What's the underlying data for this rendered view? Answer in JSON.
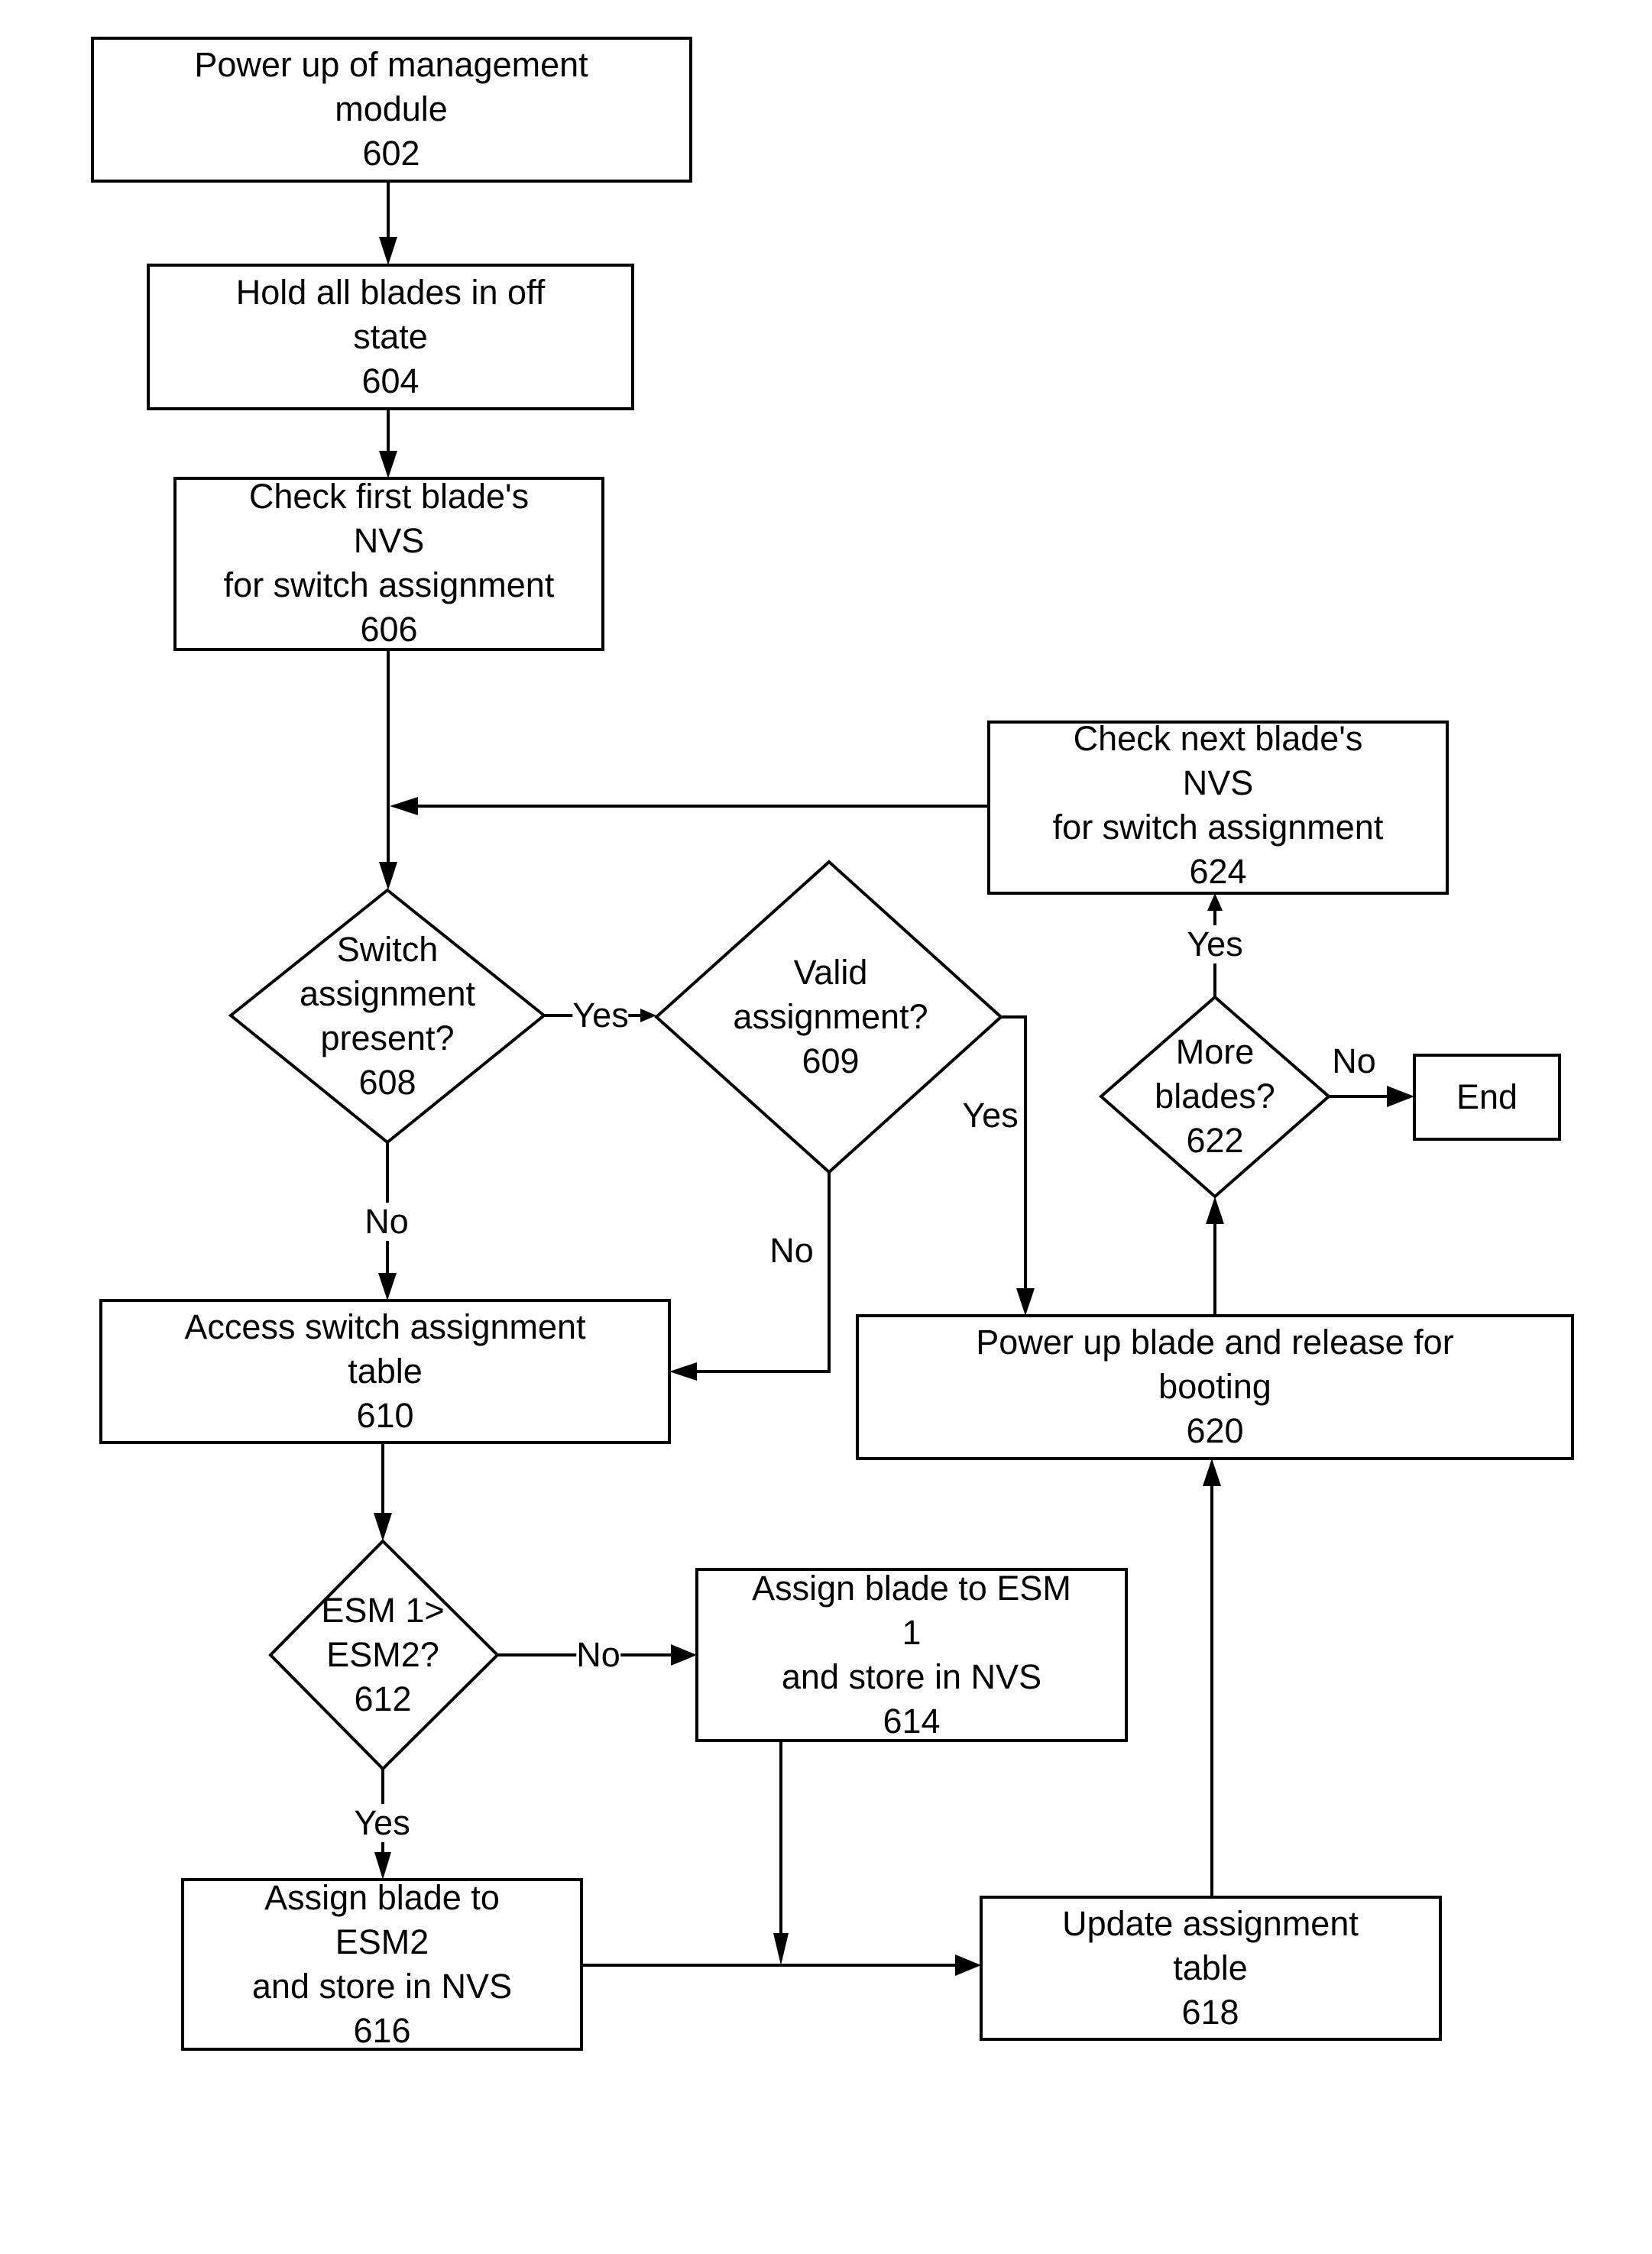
{
  "diagram": {
    "type": "flowchart",
    "nodes": [
      {
        "id": "602",
        "shape": "process",
        "lines": [
          "Power up of management",
          "module",
          "602"
        ]
      },
      {
        "id": "604",
        "shape": "process",
        "lines": [
          "Hold all blades in off",
          "state",
          "604"
        ]
      },
      {
        "id": "606",
        "shape": "process",
        "lines": [
          "Check first blade's",
          "NVS",
          "for switch assignment",
          "606"
        ]
      },
      {
        "id": "608",
        "shape": "decision",
        "lines": [
          "Switch",
          "assignment",
          "present?",
          "608"
        ]
      },
      {
        "id": "609",
        "shape": "decision",
        "lines": [
          "Valid",
          "assignment?",
          "609"
        ]
      },
      {
        "id": "610",
        "shape": "process",
        "lines": [
          "Access switch assignment",
          "table",
          "610"
        ]
      },
      {
        "id": "612",
        "shape": "decision",
        "lines": [
          "ESM 1>",
          "ESM2?",
          "612"
        ]
      },
      {
        "id": "614",
        "shape": "process",
        "lines": [
          "Assign blade to ESM",
          "1",
          "and store in NVS",
          "614"
        ]
      },
      {
        "id": "616",
        "shape": "process",
        "lines": [
          "Assign blade to",
          "ESM2",
          "and store in NVS",
          "616"
        ]
      },
      {
        "id": "618",
        "shape": "process",
        "lines": [
          "Update assignment",
          "table",
          "618"
        ]
      },
      {
        "id": "620",
        "shape": "process",
        "lines": [
          "Power up blade and release for",
          "booting",
          "620"
        ]
      },
      {
        "id": "622",
        "shape": "decision",
        "lines": [
          "More",
          "blades?",
          "622"
        ]
      },
      {
        "id": "624",
        "shape": "process",
        "lines": [
          "Check next blade's",
          "NVS",
          "for switch assignment",
          "624"
        ]
      },
      {
        "id": "end",
        "shape": "terminal",
        "lines": [
          "End"
        ]
      }
    ],
    "edges": [
      {
        "from": "602",
        "to": "604",
        "label": ""
      },
      {
        "from": "604",
        "to": "606",
        "label": ""
      },
      {
        "from": "606",
        "to": "608",
        "label": ""
      },
      {
        "from": "608",
        "to": "609",
        "label": "Yes"
      },
      {
        "from": "608",
        "to": "610",
        "label": "No"
      },
      {
        "from": "609",
        "to": "620",
        "label": "Yes"
      },
      {
        "from": "609",
        "to": "610",
        "label": "No"
      },
      {
        "from": "610",
        "to": "612",
        "label": ""
      },
      {
        "from": "612",
        "to": "614",
        "label": "No"
      },
      {
        "from": "612",
        "to": "616",
        "label": "Yes"
      },
      {
        "from": "614",
        "to": "618",
        "label": ""
      },
      {
        "from": "616",
        "to": "618",
        "label": ""
      },
      {
        "from": "618",
        "to": "620",
        "label": ""
      },
      {
        "from": "620",
        "to": "622",
        "label": ""
      },
      {
        "from": "622",
        "to": "624",
        "label": "Yes"
      },
      {
        "from": "622",
        "to": "end",
        "label": "No"
      },
      {
        "from": "624",
        "to": "608",
        "label": ""
      }
    ],
    "edge_labels": {
      "yes_608_609": "Yes",
      "no_608_610": "No",
      "yes_609_620": "Yes",
      "no_609_610": "No",
      "no_612_614": "No",
      "yes_612_616": "Yes",
      "yes_622_624": "Yes",
      "no_622_end": "No"
    }
  }
}
